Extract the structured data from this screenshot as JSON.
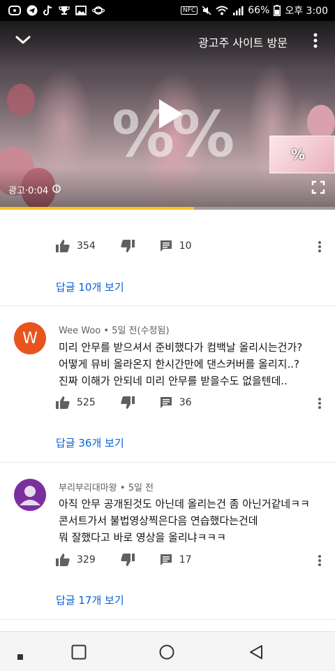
{
  "status_bar": {
    "battery": "66%",
    "time": "오후 3:00",
    "nfc": "NFC"
  },
  "player": {
    "ad_visit_label": "광고주 사이트 방문",
    "ad_time": "광고·0:04",
    "watermark": "%%",
    "thumb_watermark": "%",
    "progress": 0.58
  },
  "comments": [
    {
      "likes": "354",
      "replies_count": "10",
      "reply_link": "답글 10개 보기"
    },
    {
      "author": "Wee Woo",
      "time": "5일 전(수정됨)",
      "avatar_letter": "W",
      "avatar_color": "#e8541e",
      "text": "미리 안무를 받으셔서 준비했다가 컴백날 올리시는건가?\n어떻게 뮤비 올라온지 한시간만에 댄스커버를 올리지..?\n진짜 이해가 안되네 미리 안무를 받을수도 없을텐데..",
      "likes": "525",
      "replies_count": "36",
      "reply_link": "답글 36개 보기"
    },
    {
      "author": "부리부리대마왕",
      "time": "5일 전",
      "avatar_color": "#7b2f9e",
      "text": "아직 안무 공개된것도 아닌데 올리는건 좀 아닌거같네ㅋㅋ\n콘서트가서 불법영상찍은다음 연습했다는건데\n뭐 잘했다고 바로 영상을 올리냐ㅋㅋㅋ",
      "likes": "329",
      "replies_count": "17",
      "reply_link": "답글 17개 보기"
    }
  ],
  "colors": {
    "link": "#065fd4",
    "progress": "#f5c518"
  }
}
